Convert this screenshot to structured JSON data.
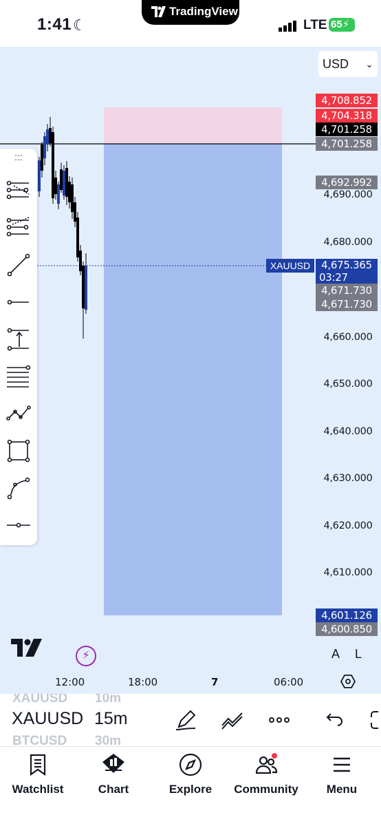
{
  "status_bar": {
    "time": "1:41",
    "island_title": "TradingView",
    "network": "LTE",
    "battery": "65"
  },
  "chart": {
    "currency": "USD",
    "symbol_tag": "XAUUSD",
    "countdown": "03:27",
    "price_tags": [
      {
        "value": "4,708.852",
        "color": "#f23645"
      },
      {
        "value": "4,704.318",
        "color": "#f23645"
      },
      {
        "value": "4,701.258",
        "color": "#000000"
      },
      {
        "value": "4,701.258",
        "color": "#787b86"
      },
      {
        "value": "4,692.992",
        "color": "#787b86"
      },
      {
        "value": "4,675.365",
        "color": "#1e3fa5"
      },
      {
        "value": "4,671.730",
        "color": "#787b86"
      },
      {
        "value": "4,671.730",
        "color": "#787b86"
      },
      {
        "value": "4,601.126",
        "color": "#1e3fa5"
      },
      {
        "value": "4,600.850",
        "color": "#787b86"
      }
    ],
    "price_axis": [
      "4,690.000",
      "4,680.000",
      "4,660.000",
      "4,650.000",
      "4,640.000",
      "4,630.000",
      "4,620.000",
      "4,610.000"
    ],
    "time_axis": [
      "12:00",
      "18:00",
      "7",
      "06:00"
    ],
    "scale_buttons": {
      "auto": "A",
      "log": "L"
    },
    "colors": {
      "stop_zone": "#f3d3e3",
      "target_zone": "#a6bdf0",
      "background": "#e3eefc",
      "up_candle": "#1e3fa5",
      "down_candle": "#000000"
    }
  },
  "drawing_tools": [
    {
      "name": "pitchfork-tool-icon"
    },
    {
      "name": "parallel-channel-tool-icon"
    },
    {
      "name": "trend-line-tool-icon"
    },
    {
      "name": "horizontal-ray-tool-icon"
    },
    {
      "name": "long-position-tool-icon"
    },
    {
      "name": "fib-retracement-tool-icon"
    },
    {
      "name": "path-tool-icon"
    },
    {
      "name": "rectangle-tool-icon"
    },
    {
      "name": "curve-tool-icon"
    },
    {
      "name": "horizontal-line-tool-icon"
    }
  ],
  "strip": {
    "symbol_prev": "XAUUSD",
    "interval_prev": "10m",
    "symbol": "XAUUSD",
    "interval": "15m",
    "symbol_next": "BTCUSD",
    "interval_next": "30m"
  },
  "nav": [
    {
      "label": "Watchlist",
      "icon": "watchlist-icon"
    },
    {
      "label": "Chart",
      "icon": "chart-icon"
    },
    {
      "label": "Explore",
      "icon": "compass-icon"
    },
    {
      "label": "Community",
      "icon": "community-icon"
    },
    {
      "label": "Menu",
      "icon": "menu-icon"
    }
  ]
}
